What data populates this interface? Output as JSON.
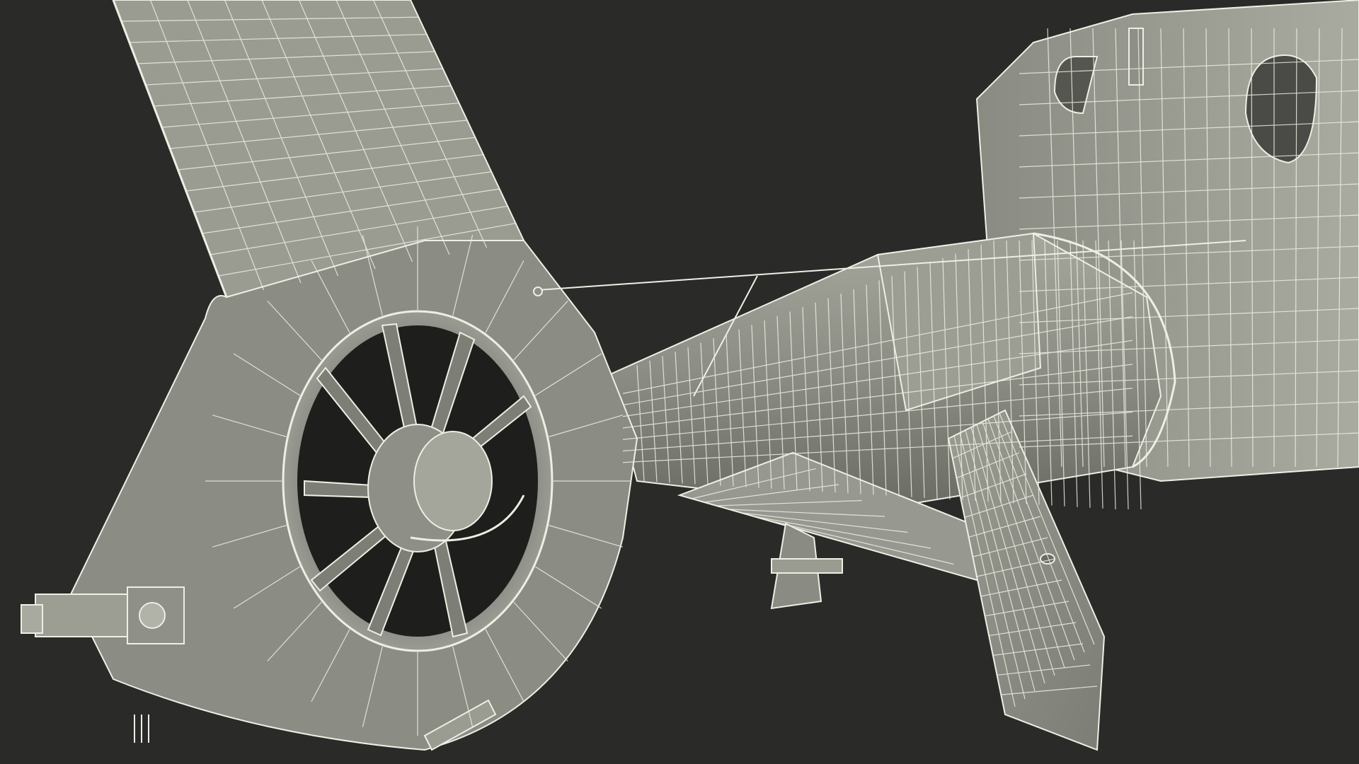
{
  "image": {
    "subject": "helicopter-tail-wireframe-render",
    "colors": {
      "background": "#2a2a29",
      "surface": "#8e8f86",
      "surface_light": "#a7a89e",
      "surface_dark": "#5f605a",
      "shadow": "#1e1e1d",
      "wire": "#eeeee4"
    }
  }
}
